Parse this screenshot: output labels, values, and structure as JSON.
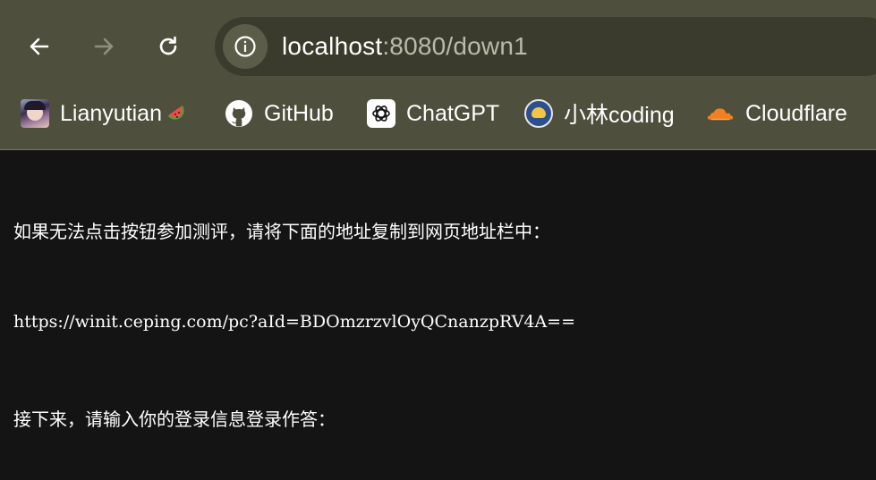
{
  "browser": {
    "url_host": "localhost",
    "url_path": ":8080/down1",
    "nav": {
      "back_icon": "arrow-left-icon",
      "forward_icon": "arrow-right-icon",
      "reload_icon": "reload-icon",
      "site_info_icon": "info-icon"
    },
    "bookmarks": [
      {
        "label": "Lianyutian",
        "icon": "avatar-icon",
        "suffix_icon": "watermelon-emoji"
      },
      {
        "label": "GitHub",
        "icon": "github-icon"
      },
      {
        "label": "ChatGPT",
        "icon": "chatgpt-icon"
      },
      {
        "label": "小林coding",
        "icon": "xiaolin-icon"
      },
      {
        "label": "Cloudflare",
        "icon": "cloudflare-icon"
      }
    ],
    "colors": {
      "toolbar": "#4e4f3c",
      "omnibox": "#3a3b2c",
      "page_background": "#141414",
      "text": "#ffffff"
    }
  },
  "page": {
    "lines": [
      "如果无法点击按钮参加测评，请将下面的地址复制到网页地址栏中：",
      "https://winit.ceping.com/pc?aId=BDOmzrzvlOyQCnanzpRV4A==",
      "接下来，请输入你的登录信息登录作答："
    ]
  }
}
